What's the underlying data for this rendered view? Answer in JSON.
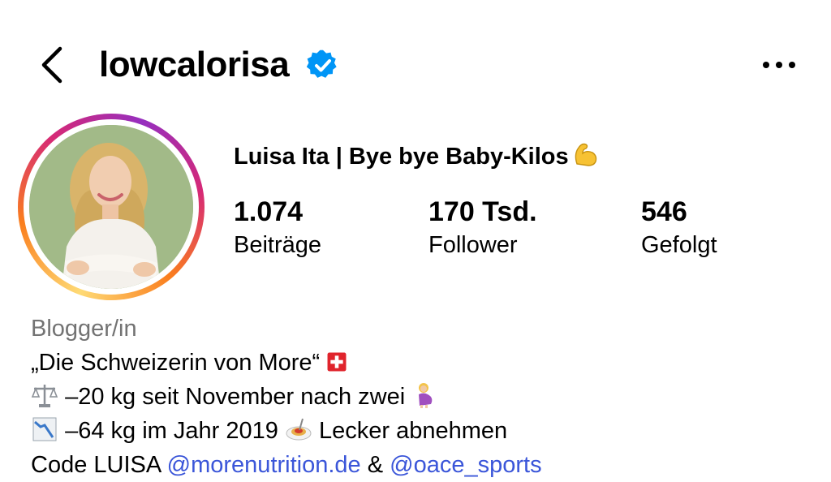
{
  "header": {
    "username": "lowcalorisa"
  },
  "profile": {
    "full_name": "Luisa Ita | Bye bye Baby-Kilos",
    "stats": [
      {
        "value": "1.074",
        "label": "Beiträge"
      },
      {
        "value": "170 Tsd.",
        "label": "Follower"
      },
      {
        "value": "546",
        "label": "Gefolgt"
      }
    ]
  },
  "bio": {
    "category": "Blogger/in",
    "line1": "„Die Schweizerin von More“",
    "line2": "–20 kg seit November nach zwei",
    "line3a": "–64 kg im Jahr 2019",
    "line3b": "Lecker abnehmen",
    "line4_prefix": "Code LUISA",
    "mention1": "@morenutrition.de",
    "amp": "&",
    "mention2": "@oace_sports"
  },
  "icons": {
    "back": "chevron-left-icon",
    "verified": "verified-badge-icon",
    "more": "more-horizontal-icon",
    "muscle": "flexed-biceps-emoji",
    "swiss_flag": "swiss-flag-emoji",
    "scale": "balance-scale-emoji",
    "pregnant": "pregnant-woman-emoji",
    "chart_down": "chart-decreasing-emoji",
    "spaghetti": "spaghetti-emoji"
  },
  "colors": {
    "link": "#3b56d9",
    "verified": "#0095f6",
    "category": "#737373"
  }
}
